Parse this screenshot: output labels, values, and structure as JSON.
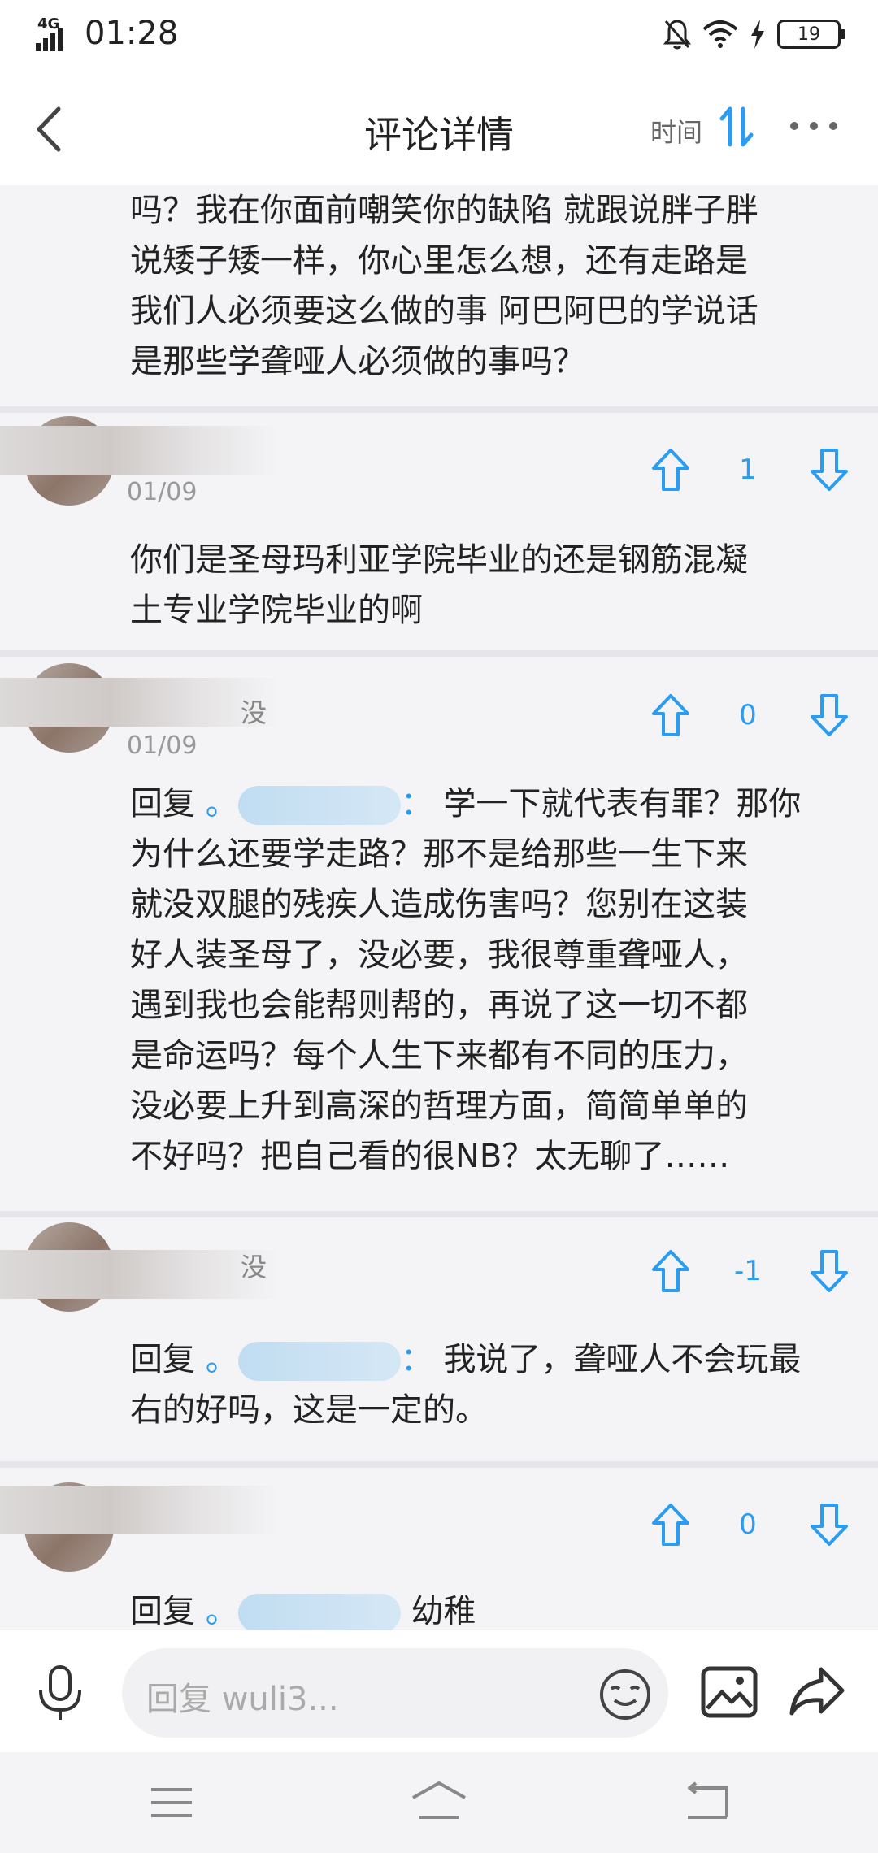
{
  "status_bar": {
    "network": "4G",
    "time": "01:28",
    "battery": "19"
  },
  "header": {
    "title": "评论详情",
    "sort_label": "时间"
  },
  "comments": [
    {
      "text_lines": [
        "吗？我在你面前嘲笑你的缺陷 就跟说胖子胖",
        "说矮子矮一样，你心里怎么想，还有走路是",
        "我们人必须要这么做的事  阿巴阿巴的学说话",
        "是那些学聋哑人必须做的事吗？"
      ]
    },
    {
      "date": "01/09",
      "votes": "1",
      "text_lines": [
        "你们是圣母玛利亚学院毕业的还是钢筋混凝",
        "土专业学院毕业的啊"
      ]
    },
    {
      "nick_suffix": "没",
      "date": "01/09",
      "votes": "0",
      "reply_prefix": "回复",
      "mention_mark": "。",
      "mention_colon": "：",
      "first_line_rest": "学一下就代表有罪？那你",
      "text_lines": [
        "为什么还要学走路？那不是给那些一生下来",
        "就没双腿的残疾人造成伤害吗？您别在这装",
        "好人装圣母了，没必要，我很尊重聋哑人，",
        "遇到我也会能帮则帮的，再说了这一切不都",
        "是命运吗？每个人生下来都有不同的压力，",
        "没必要上升到高深的哲理方面，简简单单的",
        "不好吗？把自己看的很NB？太无聊了……"
      ]
    },
    {
      "nick_suffix": "没",
      "votes": "-1",
      "reply_prefix": "回复",
      "mention_mark": "。",
      "mention_colon": "：",
      "first_line_rest": "我说了，聋哑人不会玩最",
      "text_lines": [
        "右的好吗，这是一定的。"
      ]
    },
    {
      "votes": "0",
      "reply_prefix": "回复",
      "mention_mark": "。",
      "first_line_rest": "幼稚"
    }
  ],
  "input_bar": {
    "placeholder": "回复 wuli3..."
  },
  "colors": {
    "accent": "#2a9cf2",
    "background": "#f4f4f6"
  },
  "icons": [
    "back-arrow-icon",
    "sort-icon",
    "more-icon",
    "thumb-up-icon",
    "thumb-down-icon",
    "microphone-icon",
    "emoji-icon",
    "image-icon",
    "share-icon",
    "menu-icon",
    "home-icon",
    "back-icon"
  ]
}
